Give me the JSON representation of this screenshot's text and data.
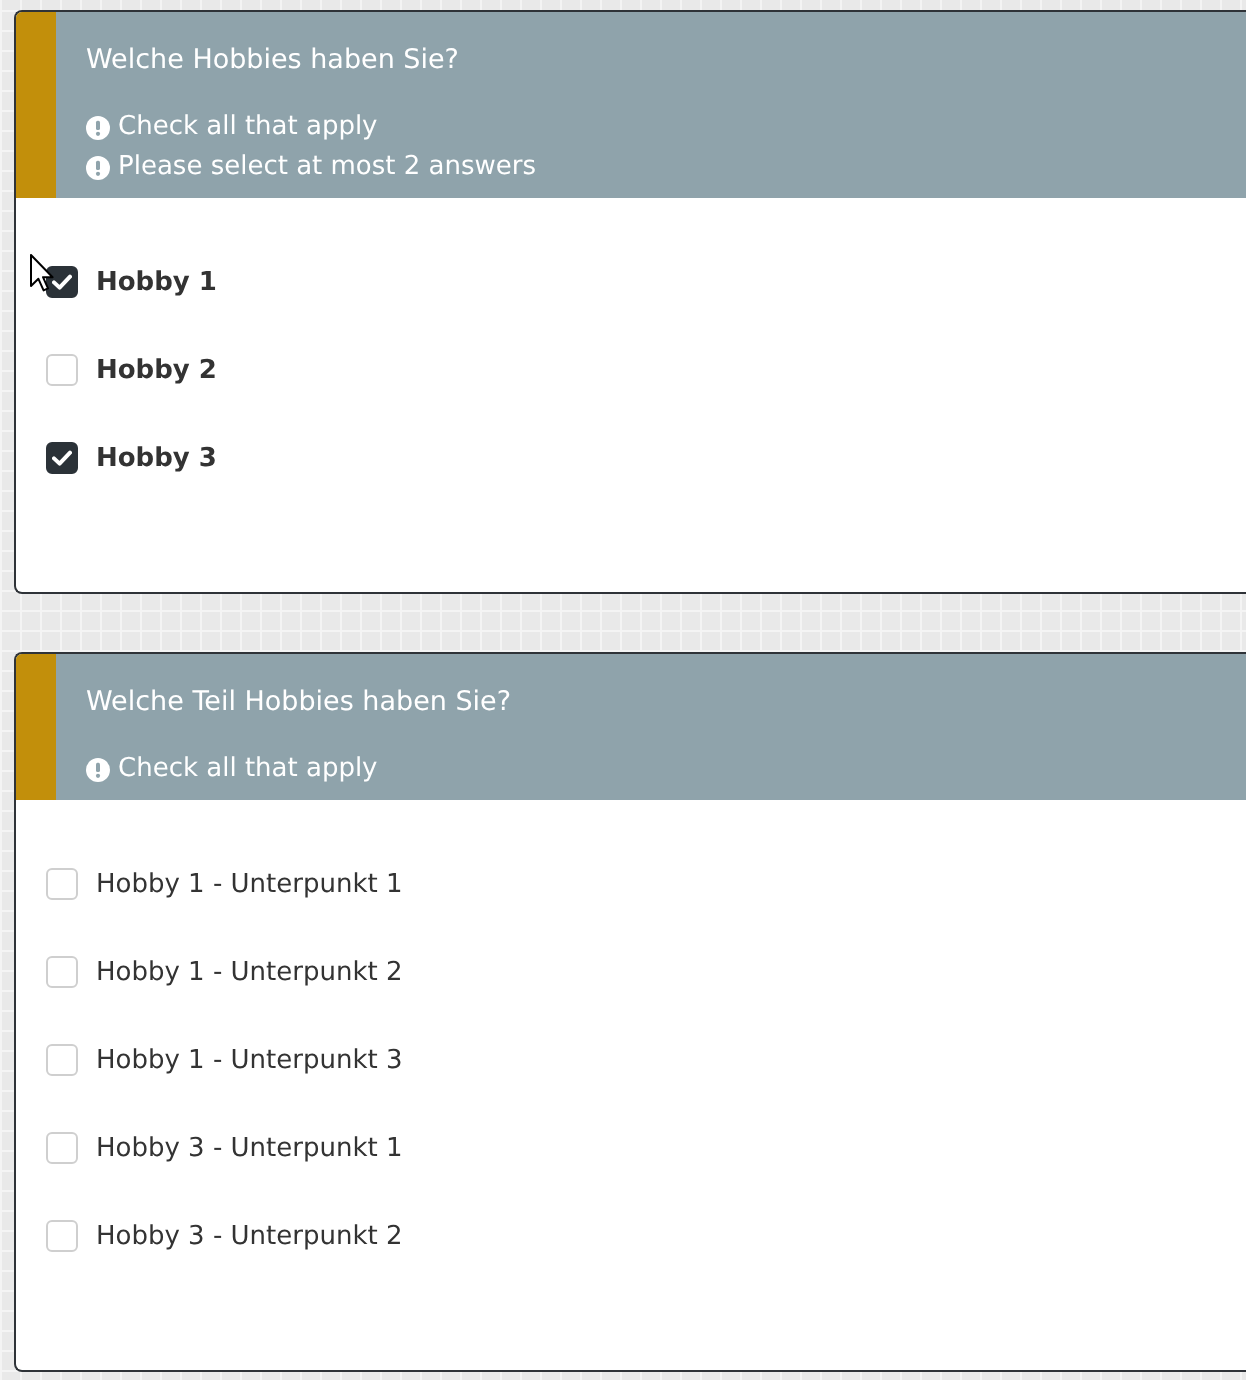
{
  "questions": [
    {
      "title": "Welche Hobbies haben Sie?",
      "hints": [
        "Check all that apply",
        "Please select at most 2 answers"
      ],
      "bold_labels": true,
      "options": [
        {
          "label": "Hobby 1",
          "checked": true
        },
        {
          "label": "Hobby 2",
          "checked": false
        },
        {
          "label": "Hobby 3",
          "checked": true
        }
      ]
    },
    {
      "title": "Welche Teil Hobbies haben Sie?",
      "hints": [
        "Check all that apply"
      ],
      "bold_labels": false,
      "options": [
        {
          "label": "Hobby 1 - Unterpunkt 1",
          "checked": false
        },
        {
          "label": "Hobby 1 - Unterpunkt 2",
          "checked": false
        },
        {
          "label": "Hobby 1 - Unterpunkt 3",
          "checked": false
        },
        {
          "label": "Hobby 3 - Unterpunkt 1",
          "checked": false
        },
        {
          "label": "Hobby 3 - Unterpunkt 2",
          "checked": false
        }
      ]
    }
  ]
}
